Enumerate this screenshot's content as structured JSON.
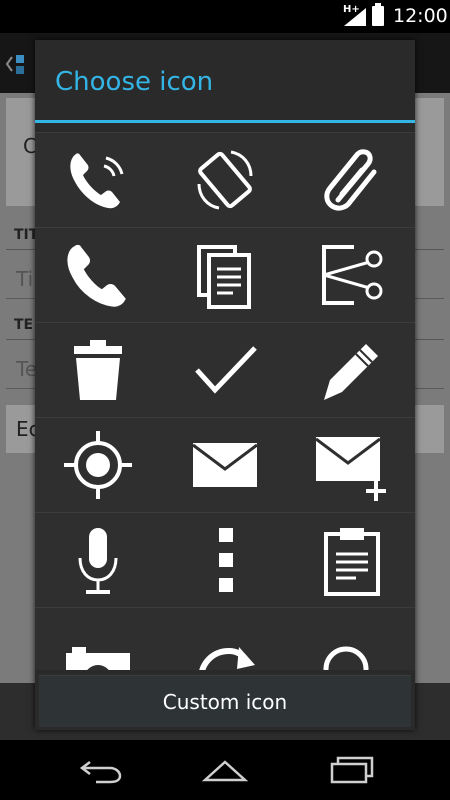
{
  "status_bar": {
    "network": "H+",
    "time": "12:00",
    "icons": [
      "signal-icon",
      "battery-icon"
    ]
  },
  "background_app": {
    "card_letter": "C",
    "title_section": "TIT",
    "title_placeholder": "Ti",
    "text_section": "TE",
    "text_placeholder": "Te",
    "edit_label": "Ec"
  },
  "dialog": {
    "title": "Choose icon",
    "accent_color": "#33b5e5",
    "icons": [
      {
        "name": "phone-ringing-icon"
      },
      {
        "name": "screen-rotation-icon"
      },
      {
        "name": "paperclip-icon"
      },
      {
        "name": "phone-icon"
      },
      {
        "name": "copy-icon"
      },
      {
        "name": "cut-icon"
      },
      {
        "name": "trash-icon"
      },
      {
        "name": "checkmark-icon"
      },
      {
        "name": "pencil-icon"
      },
      {
        "name": "location-target-icon"
      },
      {
        "name": "mail-icon"
      },
      {
        "name": "mail-add-icon"
      },
      {
        "name": "microphone-icon"
      },
      {
        "name": "overflow-menu-icon"
      },
      {
        "name": "clipboard-icon"
      },
      {
        "name": "camera-icon"
      },
      {
        "name": "refresh-icon"
      },
      {
        "name": "search-icon"
      }
    ],
    "custom_button_label": "Custom icon"
  },
  "nav_bar": {
    "icons": [
      "back-icon",
      "home-icon",
      "recent-apps-icon"
    ]
  }
}
